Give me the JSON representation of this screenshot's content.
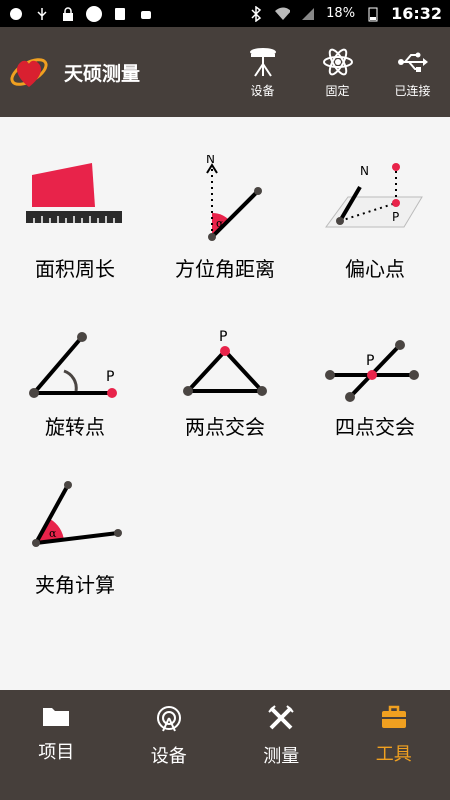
{
  "status": {
    "battery": "18%",
    "time": "16:32"
  },
  "app": {
    "title": "天硕测量"
  },
  "header_actions": [
    {
      "label": "设备",
      "icon": "gnss-rover-icon"
    },
    {
      "label": "固定",
      "icon": "atom-icon"
    },
    {
      "label": "已连接",
      "icon": "usb-icon"
    }
  ],
  "tools": [
    {
      "label": "面积周长"
    },
    {
      "label": "方位角距离",
      "north": "N",
      "alpha": "α"
    },
    {
      "label": "偏心点",
      "north": "N",
      "point": "P"
    },
    {
      "label": "旋转点",
      "point": "P"
    },
    {
      "label": "两点交会",
      "point": "P"
    },
    {
      "label": "四点交会",
      "point": "P"
    },
    {
      "label": "夹角计算",
      "alpha": "α"
    }
  ],
  "nav": [
    {
      "label": "项目",
      "icon": "folder-icon"
    },
    {
      "label": "设备",
      "icon": "device-icon"
    },
    {
      "label": "测量",
      "icon": "survey-icon"
    },
    {
      "label": "工具",
      "icon": "toolbox-icon",
      "active": true
    }
  ],
  "colors": {
    "accent": "#f0a020",
    "bar": "#463f3b",
    "point_red": "#e8234a"
  }
}
